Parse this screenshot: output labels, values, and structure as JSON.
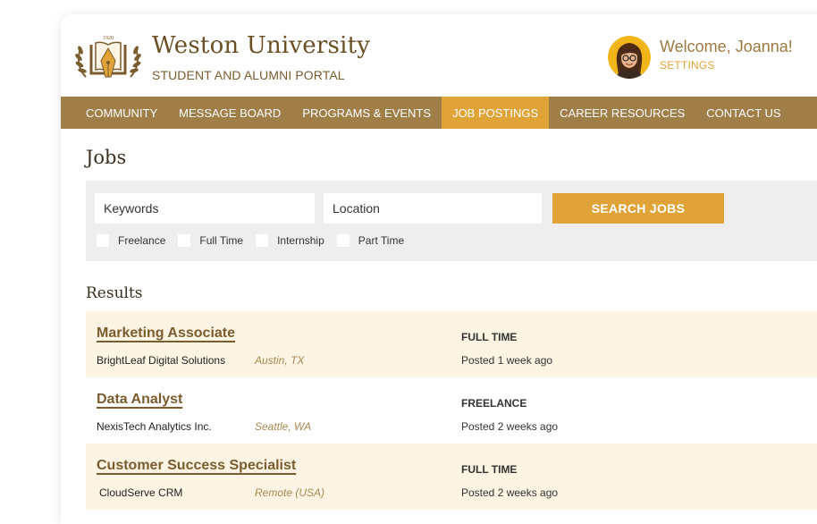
{
  "header": {
    "brand_name": "Weston University",
    "brand_sub": "STUDENT AND ALUMNI PORTAL",
    "logo_year": "1920",
    "welcome": "Welcome, Joanna!",
    "settings": "SETTINGS"
  },
  "nav": {
    "items": [
      "COMMUNITY",
      "MESSAGE BOARD",
      "PROGRAMS & EVENTS",
      "JOB POSTINGS",
      "CAREER RESOURCES",
      "CONTACT US"
    ],
    "active": "JOB POSTINGS"
  },
  "jobs_title": "Jobs",
  "search": {
    "keywords_placeholder": "Keywords",
    "location_placeholder": "Location",
    "button": "SEARCH JOBS",
    "filters": [
      "Freelance",
      "Full Time",
      "Internship",
      "Part Time"
    ]
  },
  "results_title": "Results",
  "results": [
    {
      "title": "Marketing Associate",
      "company": "BrightLeaf Digital Solutions",
      "location": "Austin, TX",
      "type": "FULL TIME",
      "posted": "Posted 1 week ago"
    },
    {
      "title": "Data Analyst",
      "company": "NexisTech Analytics Inc.",
      "location": "Seattle, WA",
      "type": "FREELANCE",
      "posted": "Posted 2 weeks ago"
    },
    {
      "title": "Customer Success Specialist",
      "company": "CloudServe CRM",
      "location": "Remote (USA)",
      "type": "FULL TIME",
      "posted": "Posted 2 weeks ago"
    }
  ],
  "colors": {
    "nav_bg": "#a07e48",
    "accent": "#e0a337",
    "brand_brown": "#6b4f22",
    "row_tint": "#fdf4e4"
  },
  "icons": {
    "logo": "pen-nib-laurel-crest-icon",
    "avatar": "user-avatar-photo"
  }
}
